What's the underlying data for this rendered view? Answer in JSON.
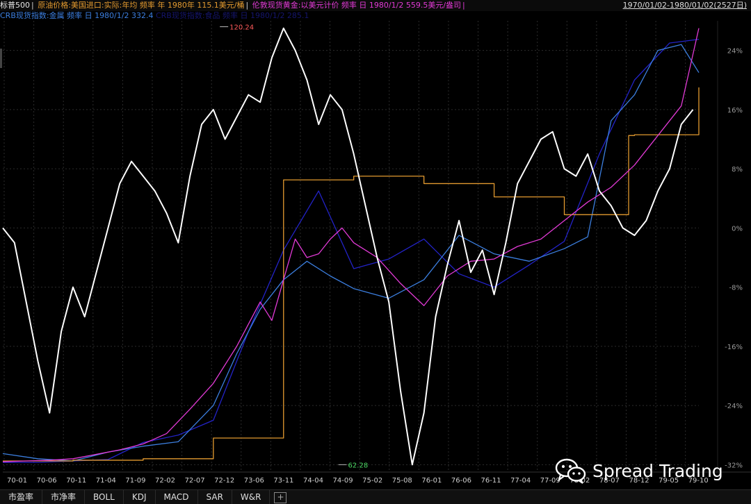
{
  "header": {
    "main_index": "标普500",
    "series_oil": "原油价格:美国进口:实际:年均 频率 年 1980年 115.1美元/桶",
    "series_gold": "伦敦现货黄金:以美元计价 频率 日 1980/1/2 559.5美元/盎司",
    "date_range": "1970/01/02-1980/01/02(2527日)",
    "series_crb": "CRB现货指数:金属 频率 日 1980/1/2 332.4",
    "series_hidden": "CRB现货指数:食品 频率 日 1980/1/2 285.1"
  },
  "tabs": [
    "市盈率",
    "市净率",
    "BOLL",
    "KDJ",
    "MACD",
    "SAR",
    "W&R"
  ],
  "tab_add_icon": "plus-icon",
  "watermark": {
    "icon": "wechat-icon",
    "text": "Spread Trading"
  },
  "colors": {
    "sp500": "#ffffff",
    "oil": "#e39a2f",
    "gold": "#e23ad6",
    "crb_metal": "#3c7fe0",
    "crb_food": "#2323c8",
    "grid": "#2c2c2c"
  },
  "chart_data": {
    "type": "line",
    "x_ticks": [
      "70-01",
      "70-06",
      "70-11",
      "71-04",
      "71-09",
      "72-02",
      "72-07",
      "72-12",
      "73-06",
      "73-11",
      "74-04",
      "74-09",
      "75-02",
      "75-08",
      "76-01",
      "76-06",
      "76-11",
      "77-04",
      "77-09",
      "78-02",
      "78-07",
      "78-12",
      "79-05",
      "79-10"
    ],
    "y_ticks": [
      "24%",
      "16%",
      "8%",
      "0%",
      "-8%",
      "-16%",
      "-24%",
      "-32%"
    ],
    "y_unit": "percent change (S&P 500 scale)",
    "ylim": [
      -33,
      28
    ],
    "annotations": [
      {
        "label": "120.24",
        "x": "72-12",
        "y": 27.2
      },
      {
        "label": "62.28",
        "x": "74-09",
        "y": -32.0
      }
    ],
    "series": [
      {
        "name": "标普500",
        "color": "#ffffff",
        "x": [
          0,
          2,
          4,
          6,
          8,
          10,
          12,
          14,
          16,
          18,
          20,
          22,
          24,
          26,
          28,
          30,
          32,
          34,
          36,
          38,
          40,
          42,
          44,
          46,
          48,
          50,
          52,
          54,
          56,
          58,
          60,
          62,
          64,
          66,
          68,
          70,
          72,
          74,
          76,
          78,
          80,
          82,
          84,
          86,
          88,
          90,
          92,
          94,
          96,
          98,
          100,
          102,
          104,
          106,
          108,
          110,
          112,
          114,
          116,
          118
        ],
        "y": [
          0,
          -2,
          -10,
          -18,
          -25,
          -14,
          -8,
          -12,
          -6,
          0,
          6,
          9,
          7,
          5,
          2,
          -2,
          7,
          14,
          16,
          12,
          15,
          18,
          17,
          23,
          27,
          24,
          20,
          14,
          18,
          16,
          10,
          3,
          -4,
          -10,
          -22,
          -32,
          -25,
          -12,
          -5,
          1,
          -6,
          -3,
          -9,
          -2,
          6,
          9,
          12,
          13,
          8,
          7,
          10,
          5,
          3,
          0,
          -1,
          1,
          5,
          8,
          14,
          16
        ]
      },
      {
        "name": "原油价格",
        "color": "#e39a2f",
        "x": [
          0,
          12,
          24,
          35,
          36,
          47,
          48,
          60,
          72,
          84,
          96,
          107,
          108,
          119
        ],
        "y": [
          -31.5,
          -31.4,
          -31.2,
          -31.2,
          -28.4,
          -28.4,
          6.5,
          7.0,
          6.0,
          4.2,
          1.8,
          12.5,
          12.6,
          19.0
        ],
        "step": true
      },
      {
        "name": "伦敦现货黄金",
        "color": "#e23ad6",
        "x": [
          0,
          4,
          8,
          12,
          16,
          20,
          24,
          28,
          32,
          36,
          40,
          44,
          46,
          48,
          50,
          52,
          54,
          56,
          58,
          60,
          64,
          68,
          72,
          76,
          80,
          84,
          88,
          92,
          96,
          100,
          104,
          108,
          112,
          116,
          119
        ],
        "y": [
          -31.6,
          -31.5,
          -31.4,
          -31.2,
          -30.6,
          -30.0,
          -29.2,
          -27.8,
          -24.5,
          -21.0,
          -16.0,
          -10.0,
          -12.5,
          -7.0,
          -1.5,
          -4.0,
          -3.5,
          -1.5,
          0.0,
          -2.0,
          -4.0,
          -7.5,
          -10.5,
          -6.5,
          -4.5,
          -4.2,
          -2.5,
          -1.5,
          1.0,
          3.5,
          5.5,
          8.5,
          12.5,
          16.5,
          27.0
        ]
      },
      {
        "name": "CRB现货指数:金属",
        "color": "#3c7fe0",
        "x": [
          0,
          6,
          12,
          18,
          24,
          30,
          36,
          40,
          44,
          48,
          52,
          56,
          60,
          66,
          72,
          78,
          84,
          90,
          96,
          100,
          104,
          108,
          112,
          116,
          119
        ],
        "y": [
          -30.5,
          -31.2,
          -31.5,
          -30.3,
          -29.5,
          -28.9,
          -24.0,
          -17.0,
          -11.0,
          -7.0,
          -4.5,
          -6.5,
          -8.2,
          -9.5,
          -7.0,
          -1.0,
          -3.5,
          -4.5,
          -2.8,
          -1.2,
          14.5,
          18.0,
          24.0,
          24.8,
          21.0
        ]
      },
      {
        "name": "CRB现货指数:食品",
        "color": "#2323c8",
        "x": [
          0,
          6,
          12,
          18,
          24,
          30,
          36,
          42,
          48,
          54,
          60,
          66,
          72,
          78,
          84,
          90,
          96,
          102,
          108,
          114,
          119
        ],
        "y": [
          -31.7,
          -31.7,
          -31.5,
          -31.3,
          -29.0,
          -28.0,
          -26.0,
          -14.0,
          -3.0,
          5.0,
          -5.5,
          -4.2,
          -1.5,
          -6.2,
          -8.0,
          -5.0,
          -1.8,
          10.0,
          20.0,
          25.0,
          25.5
        ]
      }
    ]
  }
}
